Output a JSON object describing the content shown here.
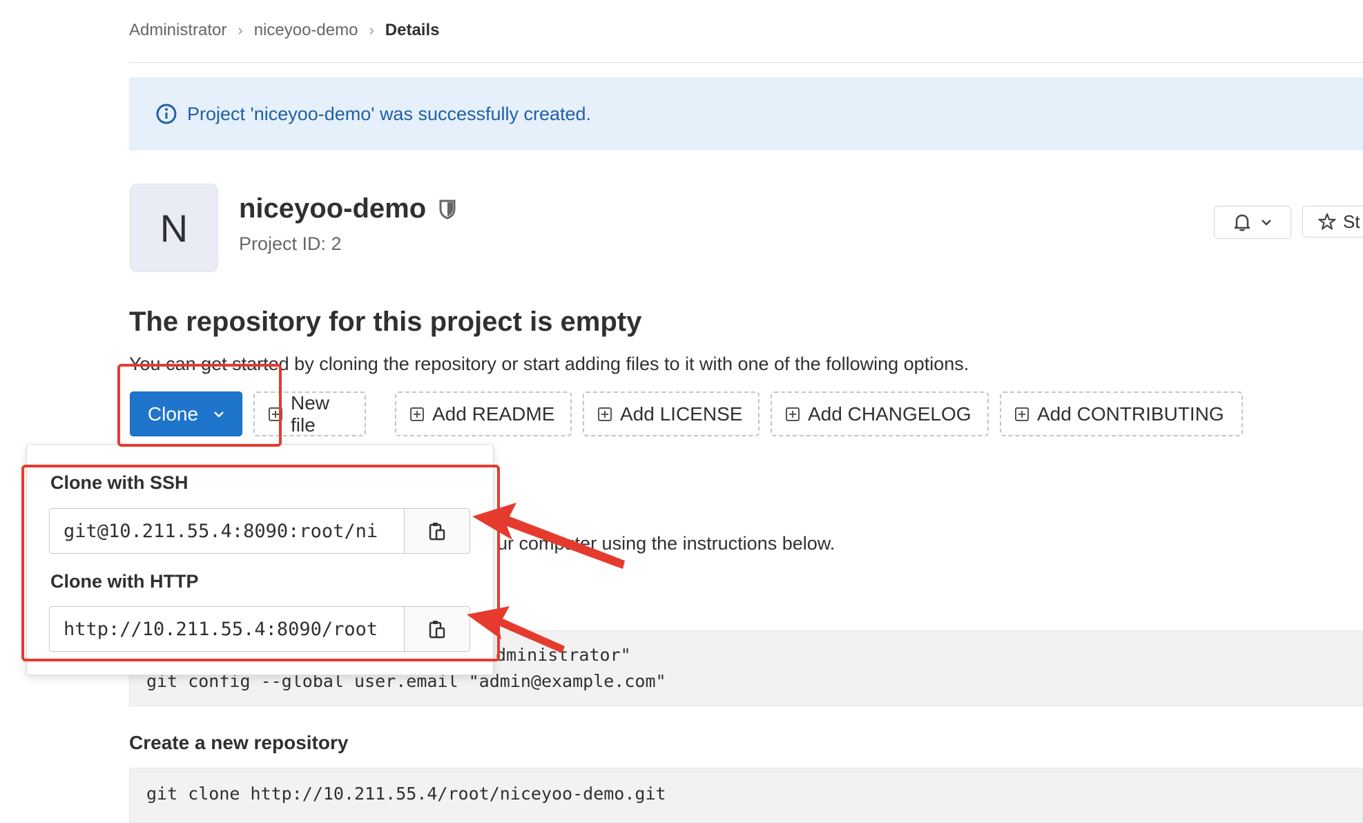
{
  "breadcrumb": {
    "items": [
      "Administrator",
      "niceyoo-demo"
    ],
    "current": "Details"
  },
  "alert": {
    "message": "Project 'niceyoo-demo' was successfully created."
  },
  "project": {
    "avatar_letter": "N",
    "name": "niceyoo-demo",
    "id_text": "Project ID: 2"
  },
  "header_actions": {
    "star_label": "St"
  },
  "empty_repo": {
    "title": "The repository for this project is empty",
    "description": "You can get started by cloning the repository or start adding files to it with one of the following options."
  },
  "actions": {
    "clone_label": "Clone",
    "new_file": "New file",
    "add_readme": "Add README",
    "add_license": "Add LICENSE",
    "add_changelog": "Add CHANGELOG",
    "add_contributing": "Add CONTRIBUTING"
  },
  "clone_dropdown": {
    "ssh_label": "Clone with SSH",
    "ssh_url": "git@10.211.55.4:8090:root/ni",
    "http_label": "Clone with HTTP",
    "http_url": "http://10.211.55.4:8090/root"
  },
  "instructions": {
    "partial_text": "ur computer using the instructions below."
  },
  "git_setup": {
    "line1": "dministrator\"",
    "line2": "git config --global user.email \"admin@example.com\""
  },
  "new_repo": {
    "heading": "Create a new repository",
    "line1": "git clone http://10.211.55.4/root/niceyoo-demo.git"
  },
  "colors": {
    "primary": "#1f75cb",
    "alert_bg": "#e6f0fa",
    "annotation": "#e53b2e"
  }
}
